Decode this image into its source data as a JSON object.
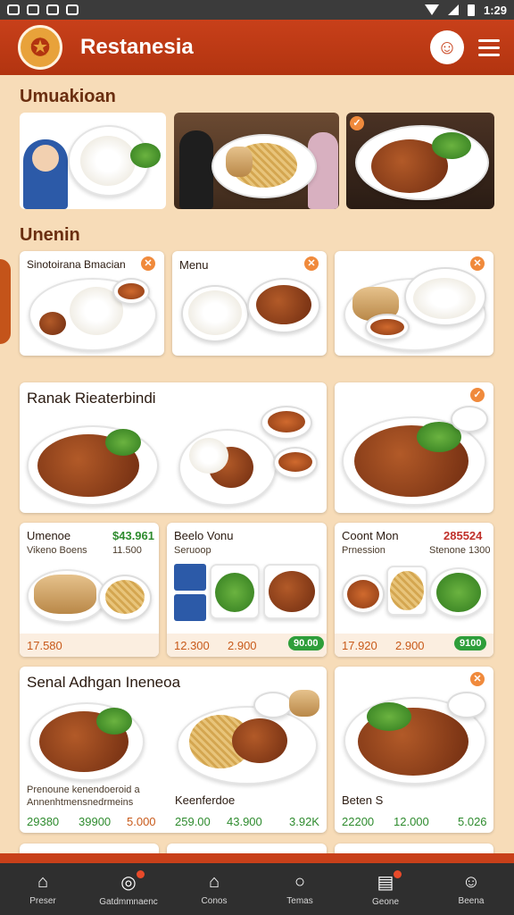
{
  "status": {
    "time": "1:29"
  },
  "app": {
    "title": "Restanesia",
    "logo_icon": "logo-emblem-icon",
    "chef_icon": "chef-icon",
    "menu_icon": "hamburger-icon"
  },
  "sections": {
    "first": "Umuakioan",
    "second": "Unenin"
  },
  "cards": {
    "c1": {
      "label": "Sinotoirana Bmacian"
    },
    "c2": {
      "label": "Menu"
    },
    "c4": {
      "label": "Ranak Rieaterbindi"
    },
    "c6": {
      "label": "Umenoe",
      "sub": "Vikeno Boens",
      "price": "$43.961",
      "sub2": "11.500",
      "bottom": "17.580"
    },
    "c7": {
      "label": "Beelo Vonu",
      "sub": "Seruoop",
      "p1": "12.300",
      "p2": "2.900",
      "pill": "90.00"
    },
    "c8": {
      "label": "Coont Mon",
      "sub": "Prnession",
      "price": "285524",
      "sub2": "Stenone 1300",
      "p1": "17.920",
      "p2": "2.900",
      "pill": "9100"
    },
    "c9": {
      "label": "Senal  Adhgan Ineneoa",
      "sub1": "Prenoune kenendoeroid a",
      "sub2": "Annenhtmensnedrmeins",
      "name2": "Keenferdoe",
      "p1": "29380",
      "p2": "39900",
      "p3": "5.000",
      "p4": "259.00",
      "p5": "43.900",
      "p6": "3.92K"
    },
    "c10": {
      "label": "Beten S",
      "p1": "22200",
      "p2": "12.000",
      "p3": "5.026"
    }
  },
  "nav": [
    {
      "label": "Preser",
      "icon": "home-icon"
    },
    {
      "label": "Gatdmmnaenc",
      "icon": "globe-icon"
    },
    {
      "label": "Conos",
      "icon": "home-icon"
    },
    {
      "label": "Temas",
      "icon": "search-icon"
    },
    {
      "label": "Geone",
      "icon": "receipt-icon"
    },
    {
      "label": "Beena",
      "icon": "profile-icon"
    }
  ],
  "colors": {
    "appbar": "#c8401a",
    "background": "#f7dcb8",
    "accent_green": "#2e9e3a",
    "badge": "#f08a3c"
  }
}
